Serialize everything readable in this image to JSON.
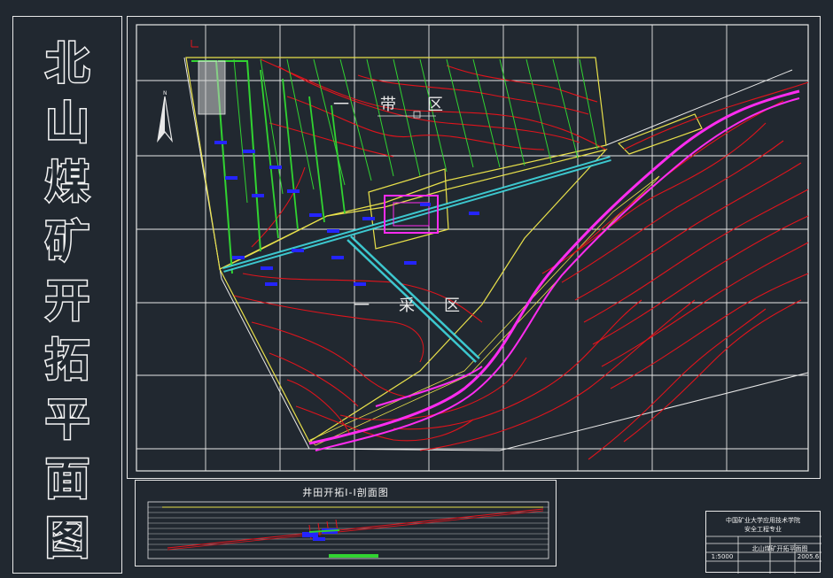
{
  "title_vertical": [
    "北",
    "山",
    "煤",
    "矿",
    "开",
    "拓",
    "平",
    "面",
    "图"
  ],
  "map": {
    "zone_labels": [
      {
        "text": "一",
        "color": "#e8e8e8"
      },
      {
        "text": "带",
        "color": "#e8e8e8"
      },
      {
        "text": "区",
        "color": "#e8e8e8"
      },
      {
        "text": "一",
        "color": "#e8e8e8"
      },
      {
        "text": "采",
        "color": "#e8e8e8"
      },
      {
        "text": "区",
        "color": "#e8e8e8"
      }
    ],
    "north_label": "N"
  },
  "section": {
    "title": "井田开拓Ⅰ-Ⅰ剖面图"
  },
  "titleblock": {
    "school": "中国矿业大学应用技术学院",
    "major": "安全工程专业",
    "drawing_name": "北山煤矿开拓平面图",
    "scale": "1:5000",
    "date": "2005.6"
  },
  "colors": {
    "background": "#212830",
    "frame": "#e8e8e8",
    "contour": "#e0141c",
    "boundary": "#e8e04a",
    "green": "#31d331",
    "cyan": "#3fd8e0",
    "magenta": "#ff2cf0",
    "blue": "#2424ff"
  }
}
